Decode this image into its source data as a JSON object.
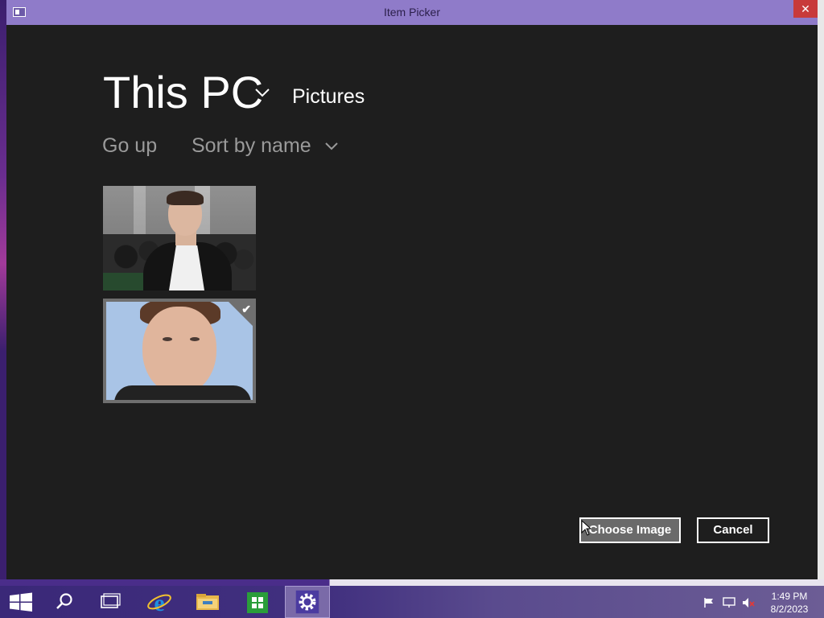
{
  "window": {
    "title": "Item Picker",
    "close_glyph": "✕"
  },
  "header": {
    "location": "This PC",
    "folder": "Pictures"
  },
  "toolbar": {
    "go_up": "Go up",
    "sort": "Sort by name"
  },
  "items": [
    {
      "name": "photo-1",
      "selected": false
    },
    {
      "name": "photo-2",
      "selected": true,
      "check_glyph": "✔"
    }
  ],
  "buttons": {
    "choose": "Choose Image",
    "cancel": "Cancel"
  },
  "taskbar": {
    "icons": [
      "windows-start-icon",
      "search-icon",
      "task-view-icon",
      "internet-explorer-icon",
      "file-explorer-icon",
      "store-icon",
      "settings-icon"
    ],
    "tray_icons": [
      "action-center-flag-icon",
      "network-icon",
      "volume-muted-icon"
    ],
    "time": "1:49 PM",
    "date": "8/2/2023"
  },
  "colors": {
    "titlebar": "#8f7bc9",
    "window_bg": "#1e1e1e",
    "close": "#c83a3a",
    "taskbar": "#3a2878"
  }
}
